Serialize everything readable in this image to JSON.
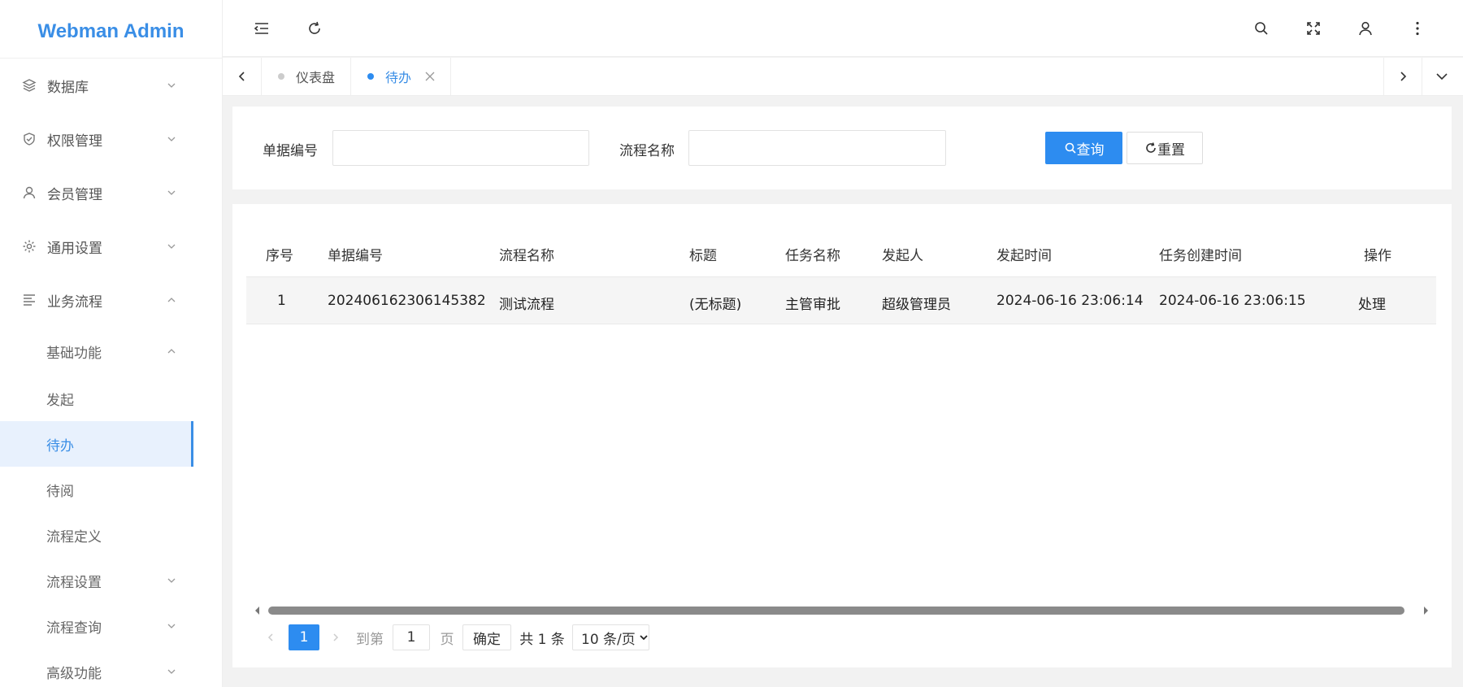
{
  "app": {
    "title": "Webman Admin",
    "accent": "#3a8ee6"
  },
  "sidebar": {
    "items": [
      {
        "label": "数据库",
        "icon": "layers-icon"
      },
      {
        "label": "权限管理",
        "icon": "shield-check-icon"
      },
      {
        "label": "会员管理",
        "icon": "user-icon"
      },
      {
        "label": "通用设置",
        "icon": "gear-icon"
      },
      {
        "label": "业务流程",
        "icon": "list-icon"
      }
    ],
    "sub": {
      "group": "基础功能",
      "items": [
        "发起",
        "待办",
        "待阅",
        "流程定义"
      ],
      "after": [
        "流程设置",
        "流程查询",
        "高级功能"
      ]
    }
  },
  "tabs": [
    {
      "label": "仪表盘"
    },
    {
      "label": "待办"
    }
  ],
  "search": {
    "doc_no_label": "单据编号",
    "flow_name_label": "流程名称",
    "query_label": "查询",
    "reset_label": "重置"
  },
  "table": {
    "headers": [
      "序号",
      "单据编号",
      "流程名称",
      "标题",
      "任务名称",
      "发起人",
      "发起时间",
      "任务创建时间",
      "操作"
    ],
    "rows": [
      [
        "1",
        "202406162306145382",
        "测试流程",
        "(无标题)",
        "主管审批",
        "超级管理员",
        "2024-06-16 23:06:14",
        "2024-06-16 23:06:15",
        "处理"
      ]
    ]
  },
  "pagination": {
    "current": "1",
    "goto_label": "到第",
    "goto_value": "1",
    "page_label": "页",
    "confirm_label": "确定",
    "total_label": "共 1 条",
    "page_size": "10 条/页"
  }
}
